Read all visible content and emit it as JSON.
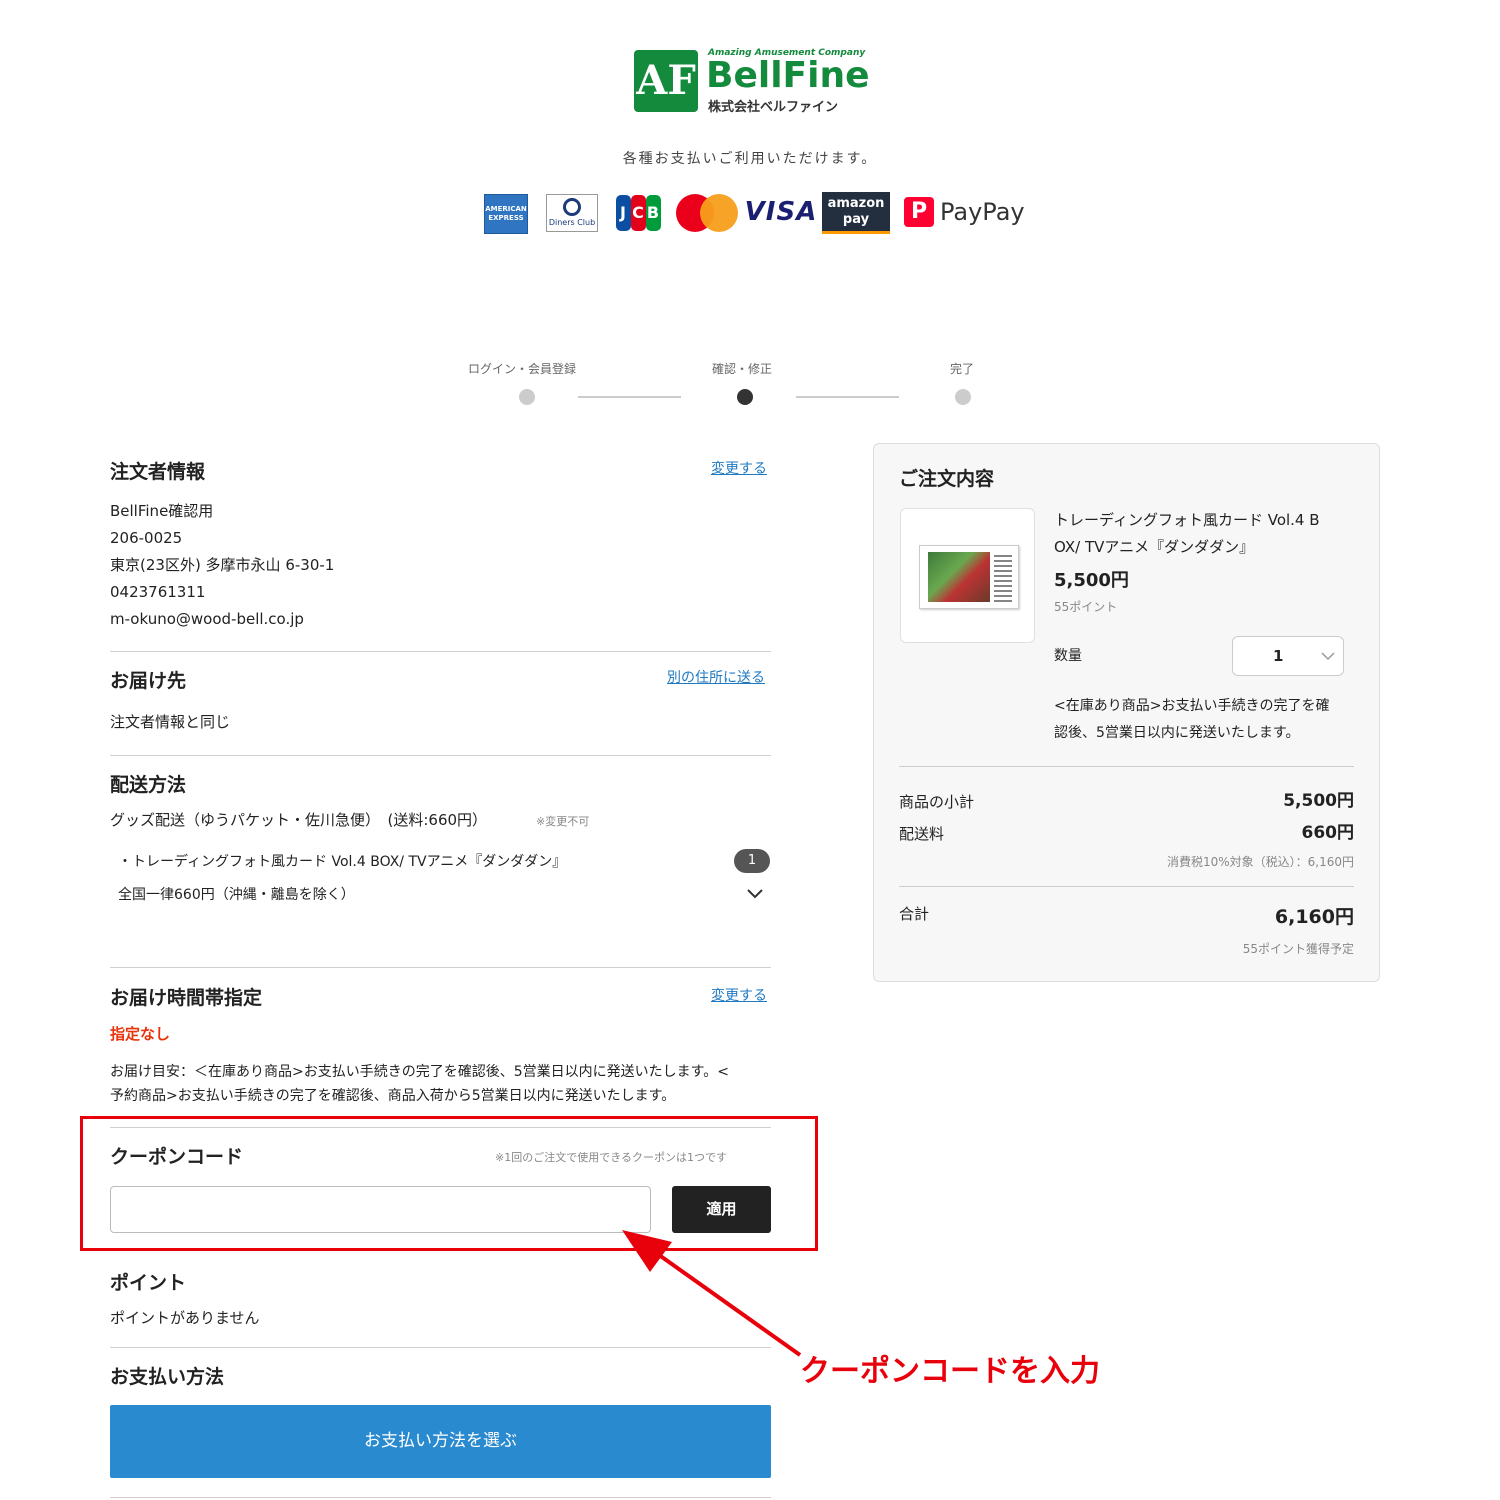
{
  "header": {
    "logo_tagline": "Amazing Amusement Company",
    "logo_name": "BellFine",
    "logo_company": "株式会社ベルファイン",
    "payment_note": "各種お支払いご利用いただけます。",
    "payment_methods": [
      "AMERICAN EXPRESS",
      "Diners Club INTERNATIONAL",
      "JCB",
      "Mastercard",
      "VISA",
      "amazon pay",
      "PayPay"
    ],
    "visa_label": "VISA",
    "amazon_label_1": "amazon",
    "amazon_label_2": "pay",
    "paypay_label": "PayPay"
  },
  "steps": [
    {
      "label": "ログイン・会員登録",
      "state": "done"
    },
    {
      "label": "確認・修正",
      "state": "current"
    },
    {
      "label": "完了",
      "state": "pending"
    }
  ],
  "orderer": {
    "title": "注文者情報",
    "change_link": "変更する",
    "lines": [
      "BellFine確認用",
      "206-0025",
      "東京(23区外) 多摩市永山 6-30-1",
      "0423761311",
      "m-okuno@wood-bell.co.jp"
    ]
  },
  "delivery": {
    "title": "お届け先",
    "change_link": "別の住所に送る",
    "value": "注文者情報と同じ"
  },
  "shipping": {
    "title": "配送方法",
    "method": "グッズ配送（ゆうパケット・佐川急便）　(送料:660円）",
    "method_note": "※変更不可",
    "item": "・トレーディングフォト風カード Vol.4 BOX/ TVアニメ『ダンダダン』",
    "item_count": "1",
    "rate": "全国一律660円（沖縄・離島を除く）"
  },
  "time_slot": {
    "title": "お届け時間帯指定",
    "change_link": "変更する",
    "value": "指定なし",
    "estimate_1": "お届け目安：＜在庫あり商品>お支払い手続きの完了を確認後、5営業日以内に発送いたします。<",
    "estimate_2": "予約商品>お支払い手続きの完了を確認後、商品入荷から5営業日以内に発送いたします。"
  },
  "coupon": {
    "title": "クーポンコード",
    "note": "※1回のご注文で使用できるクーポンは1つです",
    "input_value": "",
    "apply_label": "適用"
  },
  "points": {
    "title": "ポイント",
    "value": "ポイントがありません"
  },
  "payment": {
    "title": "お支払い方法",
    "select_label": "お支払い方法を選ぶ"
  },
  "annotation": {
    "text": "クーポンコードを入力",
    "color": "#e8000b"
  },
  "order_summary": {
    "title": "ご注文内容",
    "product_name_1": "トレーディングフォト風カード Vol.4 B",
    "product_name_2": "OX/ TVアニメ『ダンダダン』",
    "price": "5,500円",
    "points": "55ポイント",
    "qty_label": "数量",
    "qty_value": "1",
    "stock_note_1": "<在庫あり商品>お支払い手続きの完了を確",
    "stock_note_2": "認後、5営業日以内に発送いたします。",
    "subtotal_label": "商品の小計",
    "subtotal_value": "5,500円",
    "shipping_label": "配送料",
    "shipping_value": "660円",
    "tax_note": "消費税10%対象（税込）：6,160円",
    "total_label": "合計",
    "total_value": "6,160円",
    "points_earned": "55ポイント獲得予定"
  },
  "colors": {
    "brand_green": "#138a3c",
    "link_blue": "#1f7ac2",
    "primary_button": "#2a8ad0",
    "warning_red": "#e8340b"
  }
}
